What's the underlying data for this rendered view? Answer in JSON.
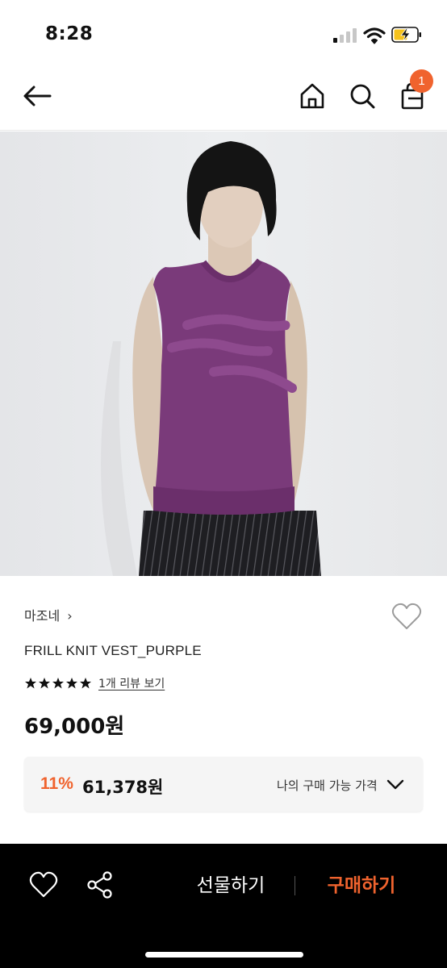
{
  "status_bar": {
    "time": "8:28",
    "icons": [
      "signal-icon",
      "wifi-icon",
      "battery-charging-icon"
    ]
  },
  "nav": {
    "icons": [
      "back-arrow-icon",
      "home-icon",
      "search-icon",
      "shopping-bag-icon"
    ],
    "cart_count": "1"
  },
  "product": {
    "image_icon": "product-photo",
    "brand": "마조네",
    "brand_chevron": "›",
    "name": "FRILL KNIT VEST_PURPLE",
    "rating_stars": 5,
    "review_link": "1개 리뷰 보기",
    "price": "69,000원"
  },
  "discount": {
    "rate": "11%",
    "price": "61,378원",
    "label": "나의 구매 가능 가격",
    "icon": "chevron-down-icon"
  },
  "bottom_bar": {
    "gift_label": "선물하기",
    "buy_label": "구매하기",
    "icons": [
      "heart-icon",
      "share-icon"
    ]
  },
  "colors": {
    "accent": "#f0632e",
    "bottom_bar_bg": "#000000",
    "discount_bg": "#f5f5f5",
    "vest": "#7a3a7a"
  }
}
